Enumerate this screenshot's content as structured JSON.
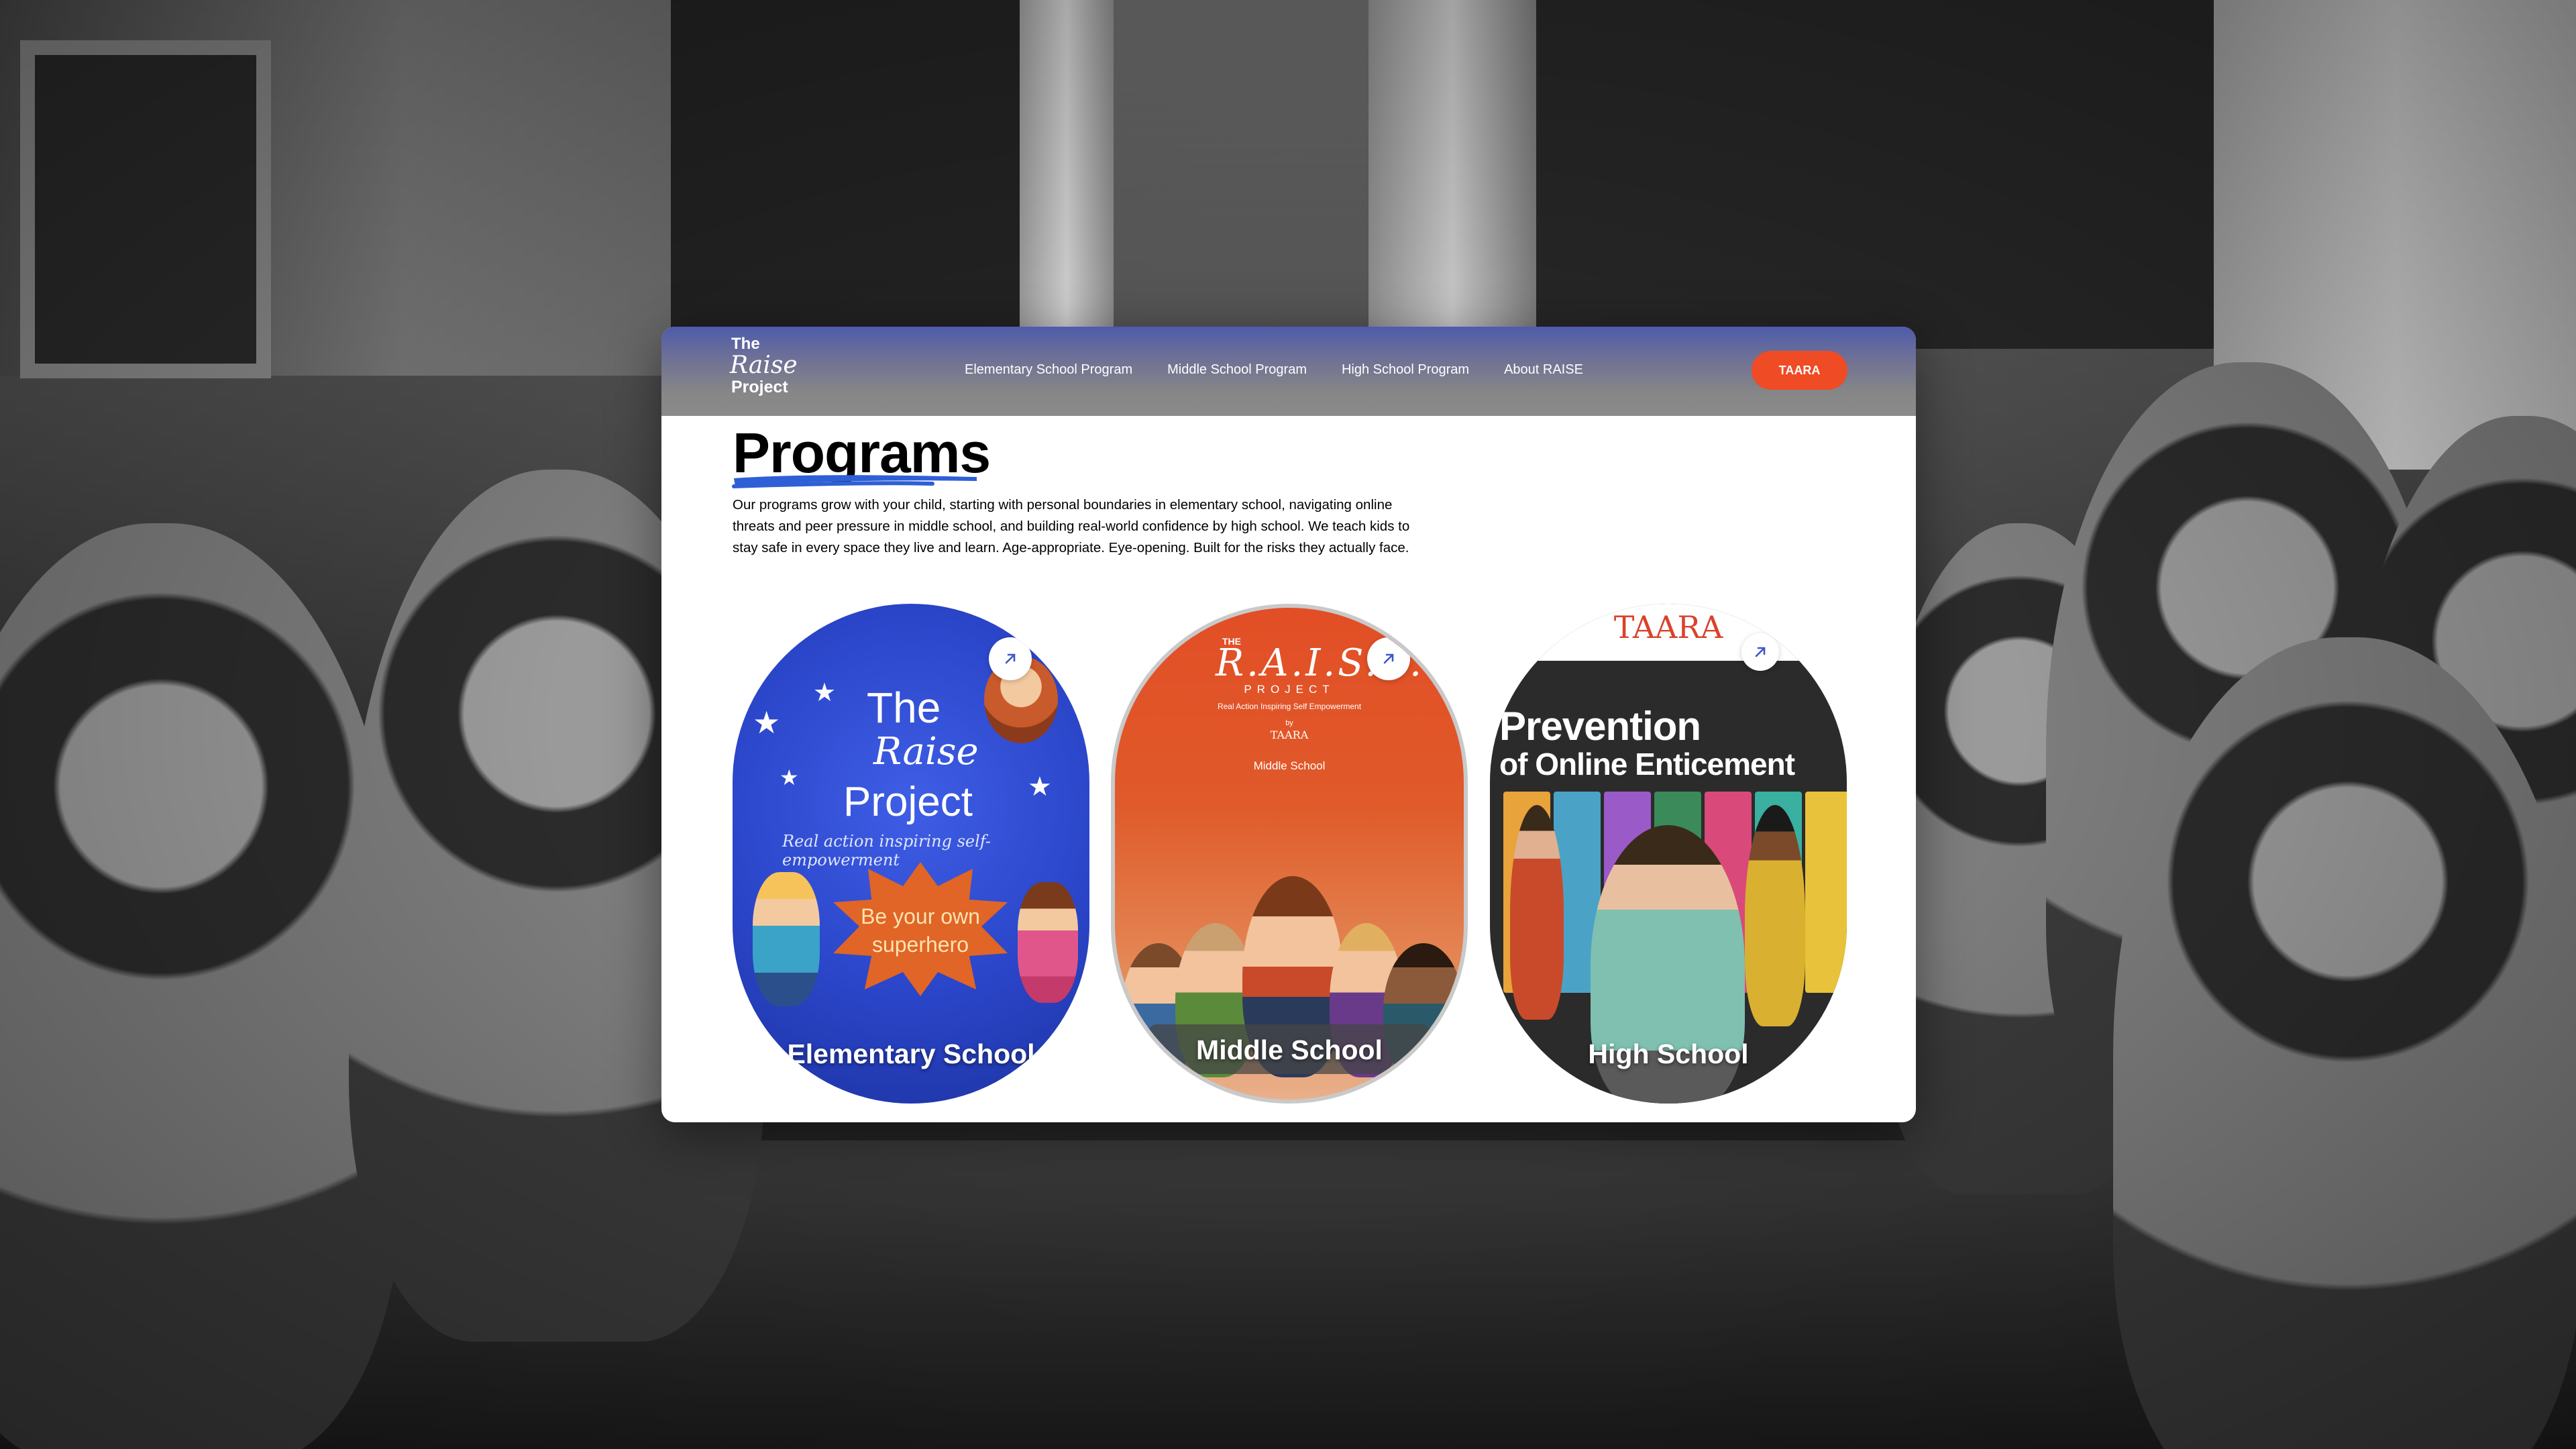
{
  "header": {
    "logo": {
      "line1": "The",
      "line2": "Raise",
      "line3": "Project"
    },
    "nav": [
      {
        "label": "Elementary School Program"
      },
      {
        "label": "Middle School Program"
      },
      {
        "label": "High School Program"
      },
      {
        "label": "About RAISE"
      }
    ],
    "cta_label": "TAARA"
  },
  "main": {
    "title": "Programs",
    "intro": "Our programs grow with your child, starting with personal boundaries in elementary school, navigating online threats and peer pressure in middle school, and building real-world confidence by high school. We teach kids to stay safe in every space they live and learn. Age-appropriate. Eye-opening. Built for the risks they actually face."
  },
  "programs": [
    {
      "label": "Elementary School",
      "cover": {
        "line1": "The",
        "line2": "Raise",
        "line3": "Project",
        "tagline": "Real action inspiring self-empowerment",
        "burst": "Be your own superhero"
      }
    },
    {
      "label": "Middle School",
      "cover": {
        "small": "THE",
        "big": "R.A.I.S.E.",
        "project": "PROJECT",
        "sub": "Real Action Inspiring Self Empowerment",
        "by": "by",
        "org": "TAARA",
        "level": "Middle School"
      }
    },
    {
      "label": "High School",
      "cover": {
        "org": "TAARA",
        "line1": "Prevention",
        "line2": "of Online Enticement"
      }
    }
  ],
  "colors": {
    "accent": "#ef4b24",
    "header_blue": "#4d5cab",
    "elementary_bg": "#2a45c8",
    "middle_bg": "#e24e26"
  },
  "icons": {
    "card_link": "arrow-up-right-icon"
  }
}
